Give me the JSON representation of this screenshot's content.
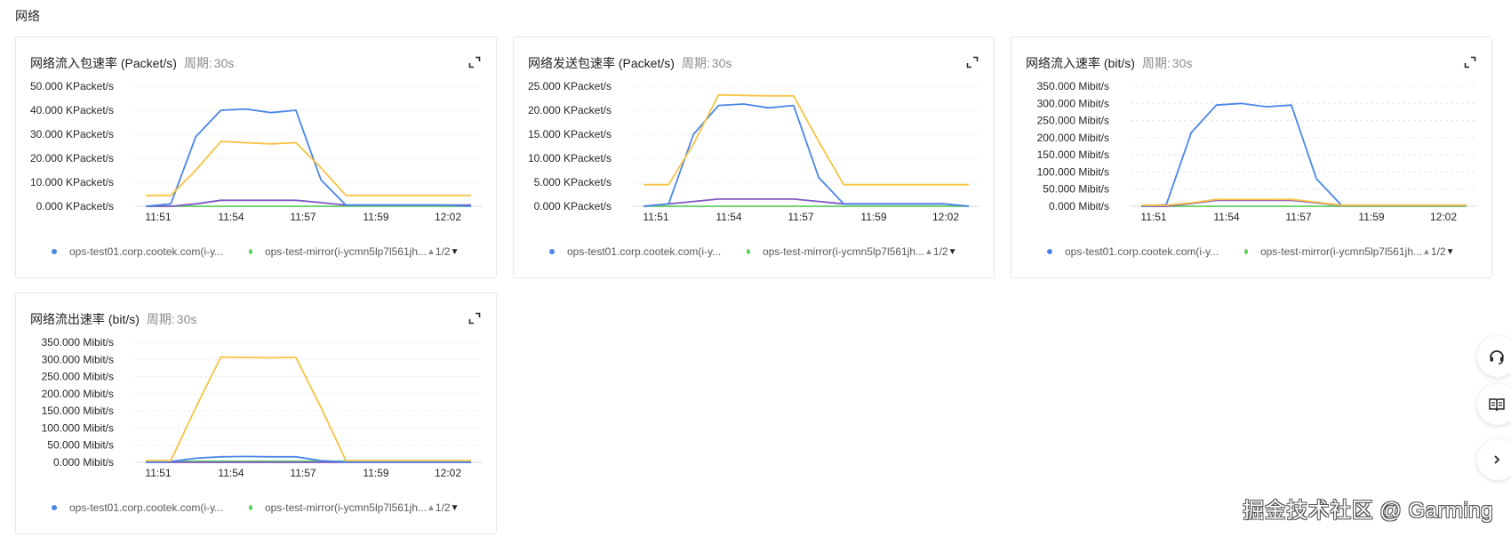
{
  "section_title": "网络",
  "period_label": "周期:",
  "period_value": "30s",
  "x_ticks": [
    "11:51",
    "11:54",
    "11:57",
    "11:59",
    "12:02"
  ],
  "legend": {
    "item1": "ops-test01.corp.cootek.com(i-y...",
    "item2": "ops-test-mirror(i-ycmn5lp7l561jh...",
    "page": "1/2"
  },
  "colors": {
    "series1": "#4a86e8",
    "series2": "#5ecf5e",
    "series3": "#f6c343",
    "series4": "#7e57c2",
    "grid": "#e8e8e8",
    "axis": "#d9d9d9"
  },
  "watermark": "掘金技术社区 @ Garming",
  "side_buttons": [
    "headset-icon",
    "book-icon",
    "chevron-right-icon"
  ],
  "chart_data": [
    {
      "type": "line",
      "title": "网络流入包速率 (Packet/s)",
      "y_ticks": [
        "50.000 KPacket/s",
        "40.000 KPacket/s",
        "30.000 KPacket/s",
        "20.000 KPacket/s",
        "10.000 KPacket/s",
        "0.000 KPacket/s"
      ],
      "ylim": [
        0,
        50
      ],
      "x": [
        "11:51",
        "11:51",
        "11:52",
        "11:53",
        "11:54",
        "11:55",
        "11:56",
        "11:57",
        "11:58",
        "11:59",
        "12:00",
        "12:01",
        "12:02",
        "12:03"
      ],
      "series": [
        {
          "values": [
            0,
            1,
            29,
            40,
            40.5,
            39,
            40,
            11,
            0.5,
            0.5,
            0.5,
            0.5,
            0.5,
            0
          ]
        },
        {
          "values": [
            0,
            0,
            0,
            0,
            0,
            0,
            0,
            0,
            0,
            0,
            0,
            0,
            0,
            0
          ]
        },
        {
          "values": [
            4.5,
            4.5,
            15,
            27,
            26.5,
            26,
            26.5,
            16,
            4.5,
            4.5,
            4.5,
            4.5,
            4.5,
            4.5
          ]
        },
        {
          "values": [
            0,
            0,
            1,
            2.5,
            2.5,
            2.5,
            2.5,
            1.5,
            0.5,
            0.5,
            0.5,
            0.5,
            0.5,
            0.5
          ]
        }
      ]
    },
    {
      "type": "line",
      "title": "网络发送包速率 (Packet/s)",
      "y_ticks": [
        "25.000 KPacket/s",
        "20.000 KPacket/s",
        "15.000 KPacket/s",
        "10.000 KPacket/s",
        "5.000 KPacket/s",
        "0.000 KPacket/s"
      ],
      "ylim": [
        0,
        25
      ],
      "x": [
        "11:51",
        "11:51",
        "11:52",
        "11:53",
        "11:54",
        "11:55",
        "11:56",
        "11:57",
        "11:58",
        "11:59",
        "12:00",
        "12:01",
        "12:02",
        "12:03"
      ],
      "series": [
        {
          "values": [
            0,
            0.5,
            15,
            21,
            21.3,
            20.5,
            21,
            6,
            0.5,
            0.5,
            0.5,
            0.5,
            0.5,
            0
          ]
        },
        {
          "values": [
            0,
            0,
            0,
            0,
            0,
            0,
            0,
            0,
            0,
            0,
            0,
            0,
            0,
            0
          ]
        },
        {
          "values": [
            4.5,
            4.5,
            13,
            23.2,
            23.1,
            23,
            23,
            13.5,
            4.5,
            4.5,
            4.5,
            4.5,
            4.5,
            4.5
          ]
        },
        {
          "values": [
            0,
            0.5,
            1,
            1.5,
            1.5,
            1.5,
            1.5,
            1,
            0.5,
            0.5,
            0.5,
            0.5,
            0.5,
            0
          ]
        }
      ]
    },
    {
      "type": "line",
      "title": "网络流入速率 (bit/s)",
      "y_ticks": [
        "350.000 Mibit/s",
        "300.000 Mibit/s",
        "250.000 Mibit/s",
        "200.000 Mibit/s",
        "150.000 Mibit/s",
        "100.000 Mibit/s",
        "50.000 Mibit/s",
        "0.000 Mibit/s"
      ],
      "ylim": [
        0,
        350
      ],
      "x": [
        "11:51",
        "11:51",
        "11:52",
        "11:53",
        "11:54",
        "11:55",
        "11:56",
        "11:57",
        "11:58",
        "11:59",
        "12:00",
        "12:01",
        "12:02",
        "12:03"
      ],
      "series": [
        {
          "values": [
            0,
            5,
            215,
            295,
            300,
            290,
            295,
            80,
            3,
            3,
            3,
            3,
            3,
            3
          ]
        },
        {
          "values": [
            0,
            0,
            0,
            0,
            0,
            0,
            0,
            0,
            0,
            0,
            0,
            0,
            0,
            0
          ]
        },
        {
          "values": [
            3,
            3,
            10,
            20,
            20,
            20,
            20,
            12,
            3,
            3,
            3,
            3,
            3,
            3
          ]
        },
        {
          "values": [
            0,
            0,
            8,
            17,
            17,
            17,
            17,
            10,
            2,
            2,
            2,
            2,
            2,
            2
          ]
        }
      ]
    },
    {
      "type": "line",
      "title": "网络流出速率 (bit/s)",
      "y_ticks": [
        "350.000 Mibit/s",
        "300.000 Mibit/s",
        "250.000 Mibit/s",
        "200.000 Mibit/s",
        "150.000 Mibit/s",
        "100.000 Mibit/s",
        "50.000 Mibit/s",
        "0.000 Mibit/s"
      ],
      "ylim": [
        0,
        350
      ],
      "x": [
        "11:51",
        "11:51",
        "11:52",
        "11:53",
        "11:54",
        "11:55",
        "11:56",
        "11:57",
        "11:58",
        "11:59",
        "12:00",
        "12:01",
        "12:02",
        "12:03"
      ],
      "series": [
        {
          "values": [
            0,
            2,
            12,
            16,
            17,
            16,
            16,
            5,
            1,
            1,
            1,
            1,
            1,
            0
          ]
        },
        {
          "values": [
            3,
            3,
            3,
            3,
            3,
            3,
            3,
            3,
            3,
            3,
            3,
            3,
            3,
            3
          ]
        },
        {
          "values": [
            5,
            5,
            160,
            307,
            306,
            305,
            306,
            160,
            5,
            5,
            5,
            5,
            5,
            5
          ]
        },
        {
          "values": [
            0,
            0,
            0,
            0,
            0,
            0,
            0,
            0,
            0,
            0,
            0,
            0,
            0,
            0
          ]
        }
      ]
    }
  ]
}
